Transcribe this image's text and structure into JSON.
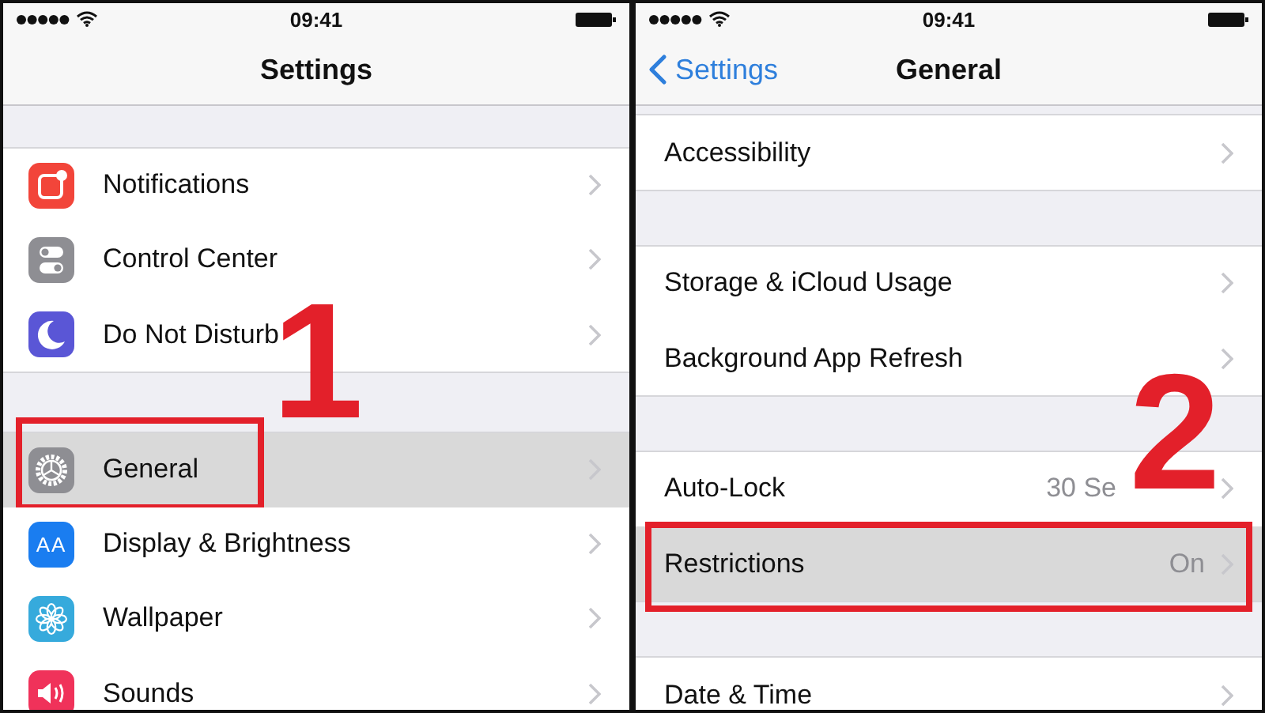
{
  "panels": [
    {
      "status_bar": {
        "time": "09:41"
      },
      "nav": {
        "title": "Settings"
      },
      "groups": [
        {
          "rows": [
            {
              "label": "Notifications",
              "selected": false
            },
            {
              "label": "Control Center",
              "selected": false
            },
            {
              "label": "Do Not Disturb",
              "selected": false
            }
          ]
        },
        {
          "rows": [
            {
              "label": "General",
              "selected": true,
              "callout": "1"
            },
            {
              "label": "Display & Brightness",
              "glyph": "AA",
              "selected": false
            },
            {
              "label": "Wallpaper",
              "selected": false
            },
            {
              "label": "Sounds",
              "selected": false
            }
          ]
        }
      ]
    },
    {
      "status_bar": {
        "time": "09:41"
      },
      "nav": {
        "back": "Settings",
        "title": "General"
      },
      "groups": [
        {
          "rows": [
            {
              "label": "Accessibility",
              "selected": false
            }
          ]
        },
        {
          "rows": [
            {
              "label": "Storage & iCloud Usage",
              "selected": false
            },
            {
              "label": "Background App Refresh",
              "selected": false
            }
          ]
        },
        {
          "rows": [
            {
              "label": "Auto-Lock",
              "value": "30 Se",
              "selected": false
            },
            {
              "label": "Restrictions",
              "value": "On",
              "selected": true,
              "callout": "2"
            }
          ]
        },
        {
          "rows": [
            {
              "label": "Date & Time",
              "selected": false
            }
          ]
        }
      ]
    }
  ]
}
